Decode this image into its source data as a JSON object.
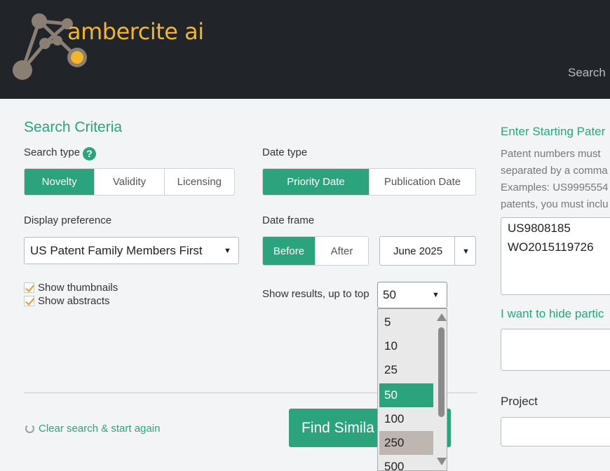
{
  "header": {
    "logo_text": "ambercite ai",
    "nav_search": "Search"
  },
  "search_criteria": {
    "title": "Search Criteria",
    "search_type_label": "Search type",
    "help_glyph": "?",
    "search_type_options": [
      "Novelty",
      "Validity",
      "Licensing"
    ],
    "search_type_active": "Novelty",
    "date_type_label": "Date type",
    "date_type_options": [
      "Priority Date",
      "Publication Date"
    ],
    "date_type_active": "Priority Date",
    "display_pref_label": "Display preference",
    "display_pref_value": "US Patent Family Members First",
    "date_frame_label": "Date frame",
    "date_frame_options": [
      "Before",
      "After"
    ],
    "date_frame_active": "Before",
    "date_value": "June 2025",
    "show_thumbnails": "Show thumbnails",
    "show_abstracts": "Show abstracts",
    "show_results_label": "Show results, up to top",
    "show_results_value": "50",
    "results_options": [
      "5",
      "10",
      "25",
      "50",
      "100",
      "250",
      "500"
    ],
    "clear_link": "Clear search & start again",
    "find_button": "Find Simila"
  },
  "right_panel": {
    "title": "Enter Starting Pater",
    "desc_lines": [
      "Patent numbers must",
      "separated by a comma",
      "Examples: US9995554",
      "patents, you must inclu"
    ],
    "patents": [
      "US9808185",
      "WO2015119726"
    ],
    "hide_title": "I want to hide partic",
    "project_label": "Project"
  },
  "colors": {
    "accent": "#2ba37c",
    "logo": "#f4b52b",
    "header_bg": "#212529",
    "check": "#e69a2e"
  }
}
